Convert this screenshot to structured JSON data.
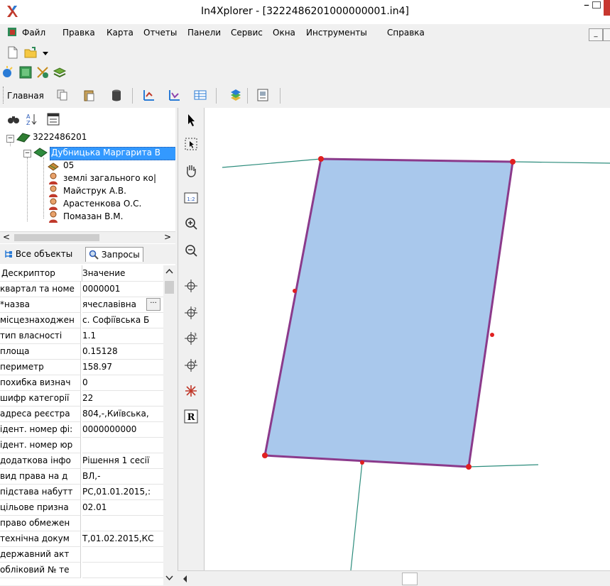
{
  "window": {
    "title": "In4Xplorer - [322248620100000000­1.in4]",
    "app_icon": "x-logo-icon",
    "controls": [
      "minimize",
      "maximize",
      "close"
    ]
  },
  "menu": [
    "Файл",
    "Правка",
    "Карта",
    "Отчеты",
    "Панели",
    "Сервис",
    "Окна",
    "Инструменты",
    "Справка"
  ],
  "toolbar": {
    "main_label": "Главная",
    "row1_icons": [
      "new-document-icon",
      "open-folder-icon",
      "dropdown-arrow-icon"
    ],
    "row2_icons": [
      "add-layer-icon",
      "map-view-icon",
      "xy-icon",
      "layers-icon"
    ],
    "row3_icons": [
      "copy-icon",
      "paste-icon",
      "database-icon",
      "edit-polyline-icon",
      "polyline-icon",
      "table-icon",
      "layer-stack-icon",
      "print-map-icon"
    ]
  },
  "tree": {
    "toolbar_icons": [
      "binoculars-icon",
      "sort-az-icon",
      "properties-icon"
    ],
    "root": "3222486201",
    "owner": "Дубницька Маргарита В",
    "children": [
      "05",
      "землі загального ко|",
      "Майструк А.В.",
      "Арастенкова О.С.",
      "Помазан В.М."
    ]
  },
  "tabs": {
    "all_objects": "Все объекты",
    "queries": "Запросы"
  },
  "grid": {
    "col_descriptor": "Дескриптор",
    "col_value": "Значение",
    "rows": [
      {
        "d": "квартал та номе",
        "v": "0000001"
      },
      {
        "d": "*назва",
        "v": "ячеславівна",
        "has_button": true
      },
      {
        "d": "місцезнаходжен",
        "v": "с. Софіївська Б"
      },
      {
        "d": "тип власності",
        "v": "1.1"
      },
      {
        "d": "площа",
        "v": "0.15128"
      },
      {
        "d": "периметр",
        "v": "158.97"
      },
      {
        "d": "похибка визнач",
        "v": "0"
      },
      {
        "d": "шифр категорії",
        "v": "22"
      },
      {
        "d": "адреса реєстра",
        "v": "804,-,Київська,"
      },
      {
        "d": "ідент. номер фі:",
        "v": "0000000000"
      },
      {
        "d": "ідент. номер юр",
        "v": ""
      },
      {
        "d": "додаткова інфо",
        "v": "Рішення 1 сесії"
      },
      {
        "d": "вид права на д",
        "v": "ВЛ,-"
      },
      {
        "d": "підстава набутт",
        "v": "РС,01.01.2015,:"
      },
      {
        "d": "цільове призна",
        "v": "02.01"
      },
      {
        "d": "право обмежен",
        "v": ""
      },
      {
        "d": "технічна докум",
        "v": "Т,01.02.2015,КС"
      },
      {
        "d": "державний акт",
        "v": ""
      },
      {
        "d": "обліковий № те",
        "v": ""
      }
    ],
    "ellipsis_label": "···"
  },
  "map_tools": [
    "arrow-select-icon",
    "select-box-icon",
    "pan-hand-icon",
    "scale-icon",
    "zoom-in-icon",
    "zoom-out-icon",
    "crosshair-1-icon",
    "crosshair-2-icon",
    "crosshair-3-icon",
    "crosshair-4-icon",
    "delete-node-icon",
    "r-button-icon"
  ],
  "map_tool_labels": {
    "scale": "1:2",
    "r": "R"
  },
  "colors": {
    "parcel_fill": "#a9c8ec",
    "parcel_stroke": "#8b3a8b",
    "vertex": "#e02020",
    "boundary_line": "#2c8c7c",
    "selection": "#3399ff"
  }
}
